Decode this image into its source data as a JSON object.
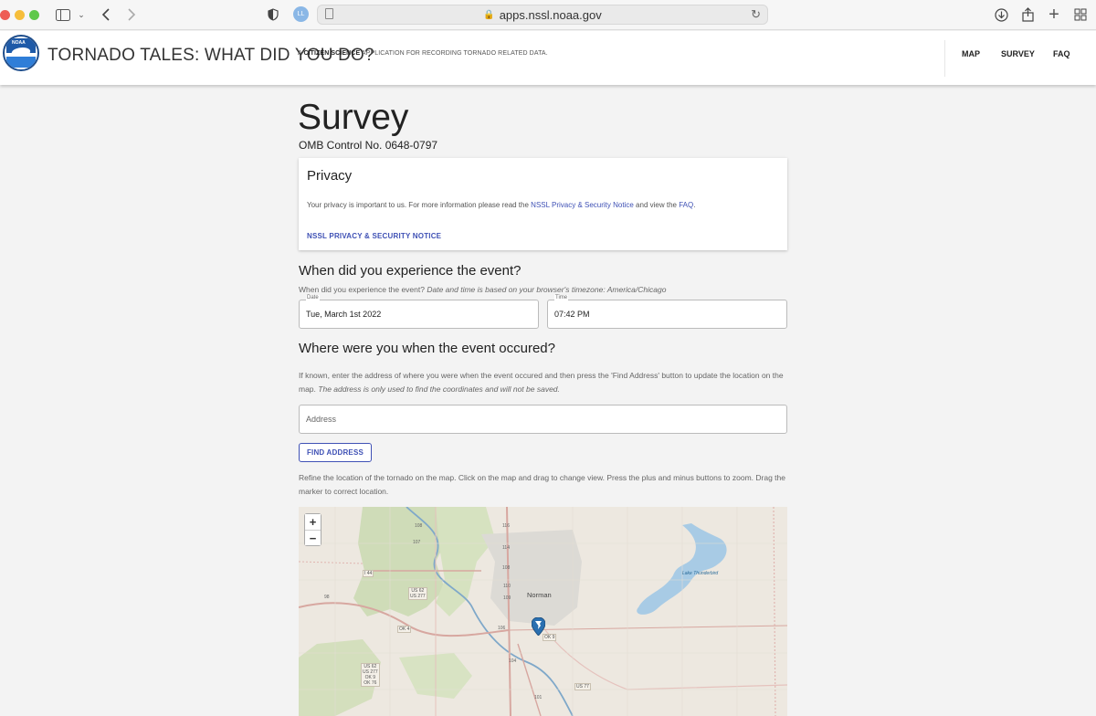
{
  "browser": {
    "url": "apps.nssl.noaa.gov",
    "profile_initials": "LL"
  },
  "header": {
    "logo_text": "NOAA",
    "title": "TORNADO TALES: WHAT DID YOU DO?",
    "tagline_prefix": "A",
    "tagline_bold": "CITIZEN SCIENCE",
    "tagline_rest": "APPLICATION FOR RECORDING TORNADO RELATED DATA.",
    "nav": [
      "MAP",
      "SURVEY",
      "FAQ"
    ]
  },
  "page": {
    "title": "Survey",
    "omb": "OMB Control No. 0648-0797"
  },
  "privacy": {
    "heading": "Privacy",
    "text_before": "Your privacy is important to us. For more information please read the",
    "link1": "NSSL Privacy & Security Notice",
    "text_mid": "and view the",
    "link2": "FAQ",
    "text_end": ".",
    "notice_button": "NSSL PRIVACY & SECURITY NOTICE"
  },
  "when": {
    "heading": "When did you experience the event?",
    "desc": "When did you experience the event?",
    "desc_italic": "Date and time is based on your browser's timezone: America/Chicago",
    "date_label": "Date",
    "date_value": "Tue, March 1st 2022",
    "time_label": "Time",
    "time_value": "07:42 PM"
  },
  "where": {
    "heading": "Where were you when the event occured?",
    "desc": "If known, enter the address of where you were when the event occured and then press the 'Find Address' button to update the location on the map.",
    "desc_italic": "The address is only used to find the coordinates and will not be saved.",
    "address_placeholder": "Address",
    "find_button": "FIND ADDRESS",
    "refine_text": "Refine the location of the tornado on the map. Click on the map and drag to change view. Press the plus and minus buttons to zoom. Drag the marker to correct location."
  },
  "map": {
    "zoom_in": "+",
    "zoom_out": "−",
    "city": "Norman",
    "lake": "Lake Thunderbird",
    "roads": {
      "i44": "I 44",
      "us62_277": "US 62\nUS 277",
      "ok4": "OK 4",
      "ok9": "OK 9",
      "us77": "US 77",
      "south_cluster": "US 62\nUS 277\nOK 9\nOK 76",
      "r108": "108",
      "r107": "107",
      "r110": "110",
      "r109": "109",
      "r106": "106",
      "r104": "104",
      "r101": "101",
      "r116": "116",
      "r114": "114",
      "r108b": "108",
      "r98": "98"
    }
  }
}
